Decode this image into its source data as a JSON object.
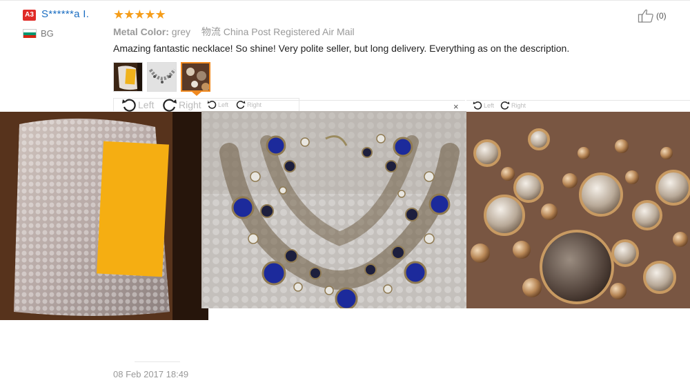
{
  "buyer": {
    "level": "A3",
    "name": "S******a I.",
    "country": "BG",
    "flag_colors": [
      "#ffffff",
      "#00966e",
      "#d62612"
    ]
  },
  "review": {
    "stars": "★★★★★",
    "star_color": "#f59d1a",
    "meta_label": "Metal Color:",
    "meta_value": "grey",
    "shipping_label": "物流",
    "shipping_value": "China Post Registered Air Mail",
    "text": "Amazing fantastic necklace! So shine! Very polite seller, but long delivery. Everything as on the description.",
    "date": "08 Feb 2017 18:49"
  },
  "helpful": {
    "icon": "thumbs-up-icon",
    "count": "(0)"
  },
  "viewer": {
    "left_label": "Left",
    "right_label": "Right",
    "close": "×",
    "accent": "#f0891f"
  }
}
